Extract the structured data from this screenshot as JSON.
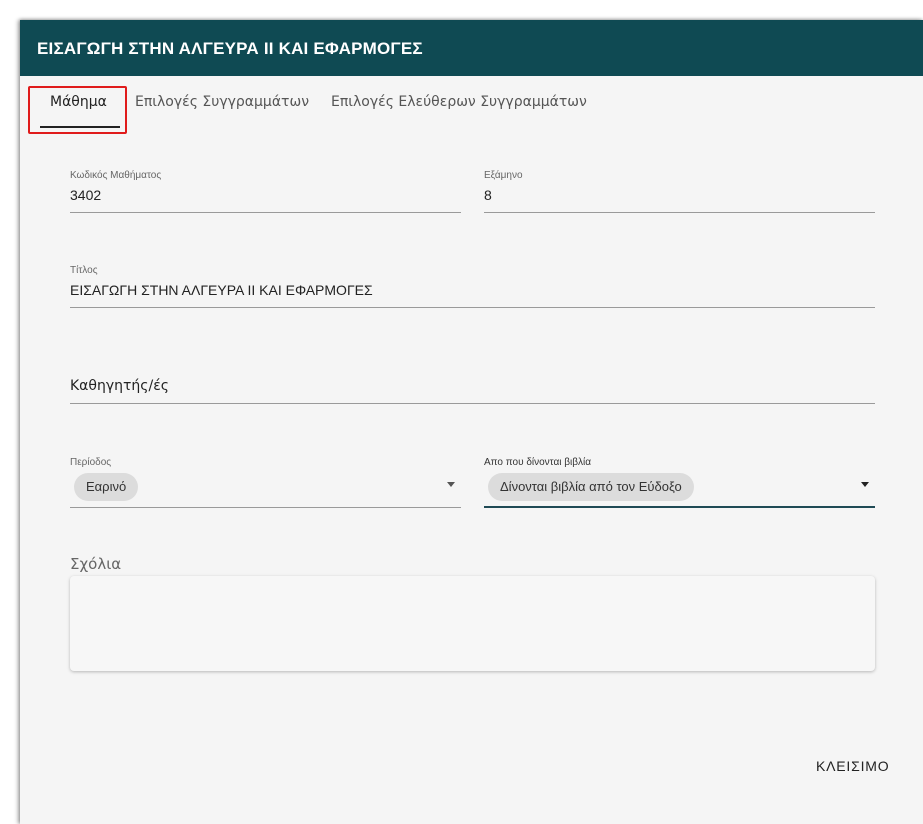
{
  "dialog": {
    "title": "ΕΙΣΑΓΩΓΗ ΣΤΗΝ ΑΛΓΕΥΡΑ ΙΙ ΚΑΙ ΕΦΑΡΜΟΓΕΣ",
    "close_label": "ΚΛΕΙΣΙΜΟ"
  },
  "tabs": [
    {
      "label": "Μάθημα",
      "active": true
    },
    {
      "label": "Επιλογές Συγγραμμάτων",
      "active": false
    },
    {
      "label": "Επιλογές Ελεύθερων Συγγραμμάτων",
      "active": false
    }
  ],
  "form": {
    "course_code": {
      "label": "Κωδικός Μαθήματος",
      "value": "3402"
    },
    "semester": {
      "label": "Εξάμηνο",
      "value": "8"
    },
    "title": {
      "label": "Τίτλος",
      "value": "ΕΙΣΑΓΩΓΗ ΣΤΗΝ ΑΛΓΕΥΡΑ ΙΙ ΚΑΙ ΕΦΑΡΜΟΓΕΣ"
    },
    "professors": {
      "placeholder": "Καθηγητής/ές"
    },
    "period": {
      "label": "Περίοδος",
      "value": "Εαρινό"
    },
    "books_source": {
      "label": "Απο που δίνονται βιβλία",
      "value": "Δίνονται βιβλία από τον Εύδοξο"
    },
    "comments": {
      "label": "Σχόλια"
    }
  },
  "colors": {
    "header_bg": "#0f4a53",
    "highlight": "#e01b1b"
  }
}
